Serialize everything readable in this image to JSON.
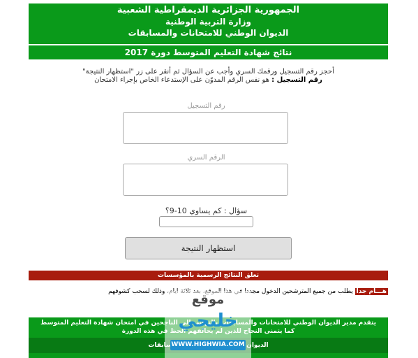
{
  "header": {
    "line1": "الجمهورية الجزائرية الديمقراطية الشعبية",
    "line2": "وزارة التربية الوطنية",
    "line3": "الديوان الوطني للامتحانات والمسابقات"
  },
  "results_title": "نتائج شهادة التعليم المتوسط دورة 2017",
  "instructions": {
    "line1": "أحجز رقم التسجيل ورقمك السري وأجب عن السؤال ثم أنقر على زر \"استظهار النتيجة\"",
    "line2_bold": "رقم التسجيل :",
    "line2_rest": " هو نفس الرقم المدوّن على الإستدعاء الخاص بإجراء الامتحان"
  },
  "form": {
    "registration_label": "رقم التسجيل",
    "secret_label": "الرقم السري",
    "captcha_question": "سؤال : كم يساوي 10-9؟",
    "submit_label": "استظهار النتيجة"
  },
  "red_bar": "تعلق النتائج الرسمية بالمؤسسات",
  "notice": {
    "badge": "هـــام جدا",
    "text": "يطلب من جميع المترشحين الدخول مجددا في هذا الموقع، بعد ثلاثة ايام، وذلك لسحب كشوفهم"
  },
  "bottom": {
    "line1": "يتقدم مدير الديوان الوطني للامتحانات والمسابقات بالتهاني إلى الناجحين في امتحان شهادة التعليم المتوسط",
    "line2": "كما يتمنى النجاح للذين لم يحالفهم الحظ في هذه الدورة",
    "line3": "الديوان الوطني للامتحانات والمسابقات"
  },
  "watermark": {
    "top": "موقع",
    "middle": "خليجي",
    "url": "WWW.HIGHWIA.COM"
  },
  "colors": {
    "green": "#0a9a1a",
    "red": "#a81c0e",
    "brand_blue": "#1f8fcf"
  }
}
